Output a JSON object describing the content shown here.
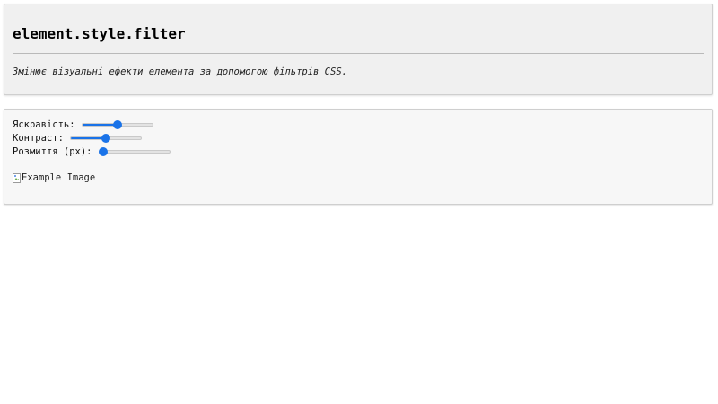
{
  "header": {
    "title": "element.style.filter",
    "description": "Змінює візуальні ефекти елемента за допомогою фільтрів CSS."
  },
  "controls": [
    {
      "label": "Яскравість:",
      "min": 0,
      "max": 200,
      "value": 100,
      "fraction": 0.5
    },
    {
      "label": "Контраст:",
      "min": 0,
      "max": 200,
      "value": 100,
      "fraction": 0.5
    },
    {
      "label": "Розмиття (px):",
      "min": 0,
      "max": 10,
      "value": 0,
      "fraction": 0.0
    }
  ],
  "image": {
    "alt": "Example Image",
    "icon": "broken-image-icon"
  },
  "colors": {
    "accent": "#1a73e8",
    "header_background": "#f0f0f0",
    "controls_background": "#f7f7f7"
  }
}
